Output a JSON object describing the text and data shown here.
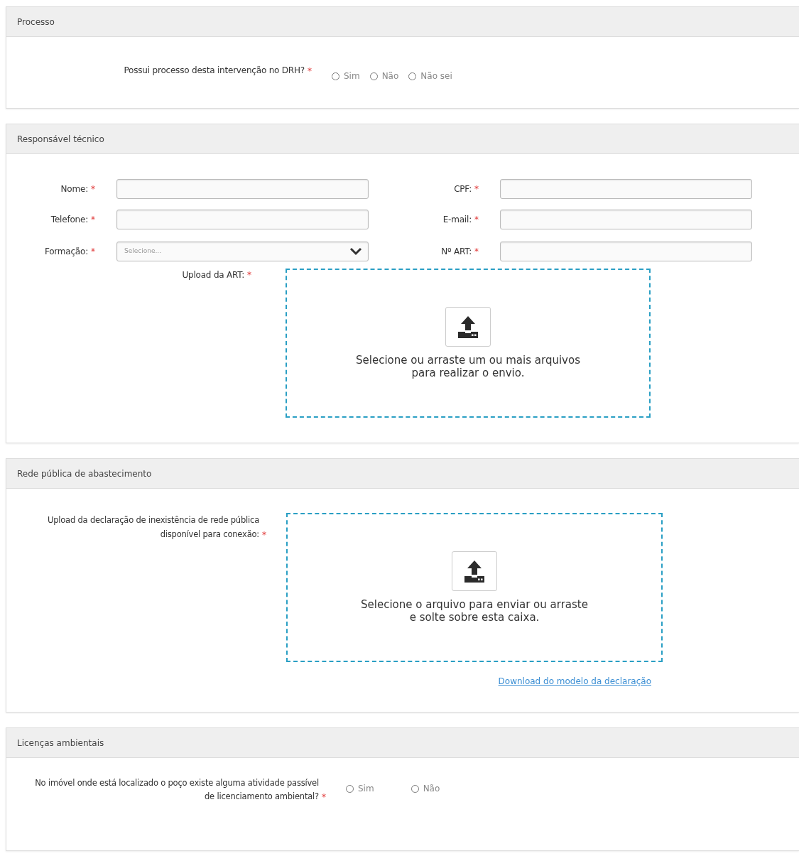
{
  "sections": [
    {
      "title": "Processo",
      "kind": "question",
      "question": {
        "label": "Possui processo desta intervenção no DRH?",
        "required_mark": "*",
        "options": [
          {
            "label": "Sim",
            "selected": false
          },
          {
            "label": "Não",
            "selected": false
          },
          {
            "label": "Não sei",
            "selected": false
          }
        ]
      }
    },
    {
      "title": "Responsável técnico",
      "kind": "fields",
      "fields": [
        {
          "label": "Nome:",
          "required_mark": "*",
          "kind": "text"
        },
        {
          "label": "CPF:",
          "required_mark": "*",
          "kind": "text"
        },
        {
          "label": "Telefone:",
          "required_mark": "*",
          "kind": "text"
        },
        {
          "label": "E-mail:",
          "required_mark": "*",
          "kind": "text"
        },
        {
          "label": "Formação:",
          "required_mark": "*",
          "kind": "select",
          "placeholder": "Selecione..."
        },
        {
          "label": "Nº ART:",
          "required_mark": "*",
          "kind": "text"
        }
      ],
      "upload": {
        "label": "Upload da ART:",
        "required_mark": "*",
        "text": "Selecione ou arraste um ou mais arquivos para realizar o envio."
      }
    },
    {
      "title": "Rede pública de abastecimento",
      "kind": "upload",
      "upload": {
        "label": "Upload da declaração de inexistência de rede pública disponível para conexão:",
        "required_mark": "*",
        "text": "Selecione o arquivo para enviar ou arraste e solte sobre esta caixa."
      },
      "link": "Download do modelo da declaração"
    },
    {
      "title": "Licenças ambientais",
      "kind": "question",
      "question": {
        "label": "No imóvel onde está localizado o poço existe alguma atividade passível de licenciamento ambiental?",
        "required_mark": "*",
        "options": [
          {
            "label": "Sim",
            "selected": false
          },
          {
            "label": "Não",
            "selected": false
          }
        ]
      }
    }
  ]
}
